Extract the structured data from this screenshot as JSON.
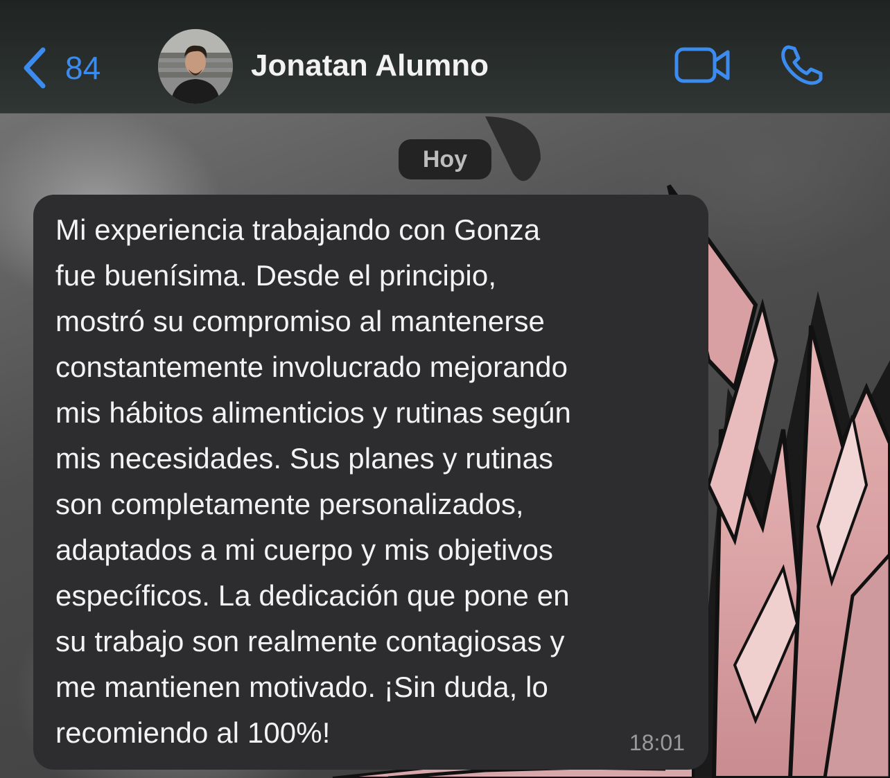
{
  "header": {
    "back_count": "84",
    "contact_name": "Jonatan Alumno",
    "avatar_icon": "contact-avatar",
    "icons": [
      "chevron-left-icon",
      "video-camera-icon",
      "phone-icon"
    ],
    "accent_color": "#3c8cf0"
  },
  "chat": {
    "date_label": "Hoy",
    "messages": [
      {
        "lines": [
          "Mi experiencia trabajando con Gonza",
          "fue buenísima. Desde el principio,",
          "mostró su compromiso al mantenerse",
          "constantemente involucrado mejorando",
          "mis hábitos alimenticios y rutinas según",
          "mis necesidades. Sus planes y rutinas",
          "son completamente personalizados,",
          "adaptados a mi cuerpo y mis objetivos",
          "específicos. La dedicación que pone en",
          "su trabajo son realmente contagiosas y",
          "me mantienen motivado. ¡Sin duda, lo",
          "recomiendo al 100%!"
        ],
        "time": "18:01",
        "bubble_color": "#2d2d2f"
      }
    ]
  }
}
